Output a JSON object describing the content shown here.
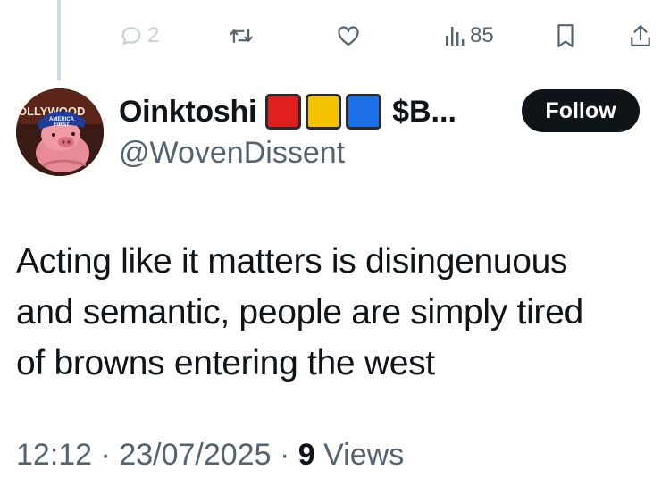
{
  "actions": {
    "reply_count": "2",
    "views_count": "85"
  },
  "user": {
    "display_name": "Oinktoshi",
    "ticker": "$B...",
    "handle": "@WovenDissent",
    "flag_colors": [
      "#e0201f",
      "#f5c200",
      "#1d6fe6"
    ],
    "avatar_hat_text_line1": "AMERICA",
    "avatar_hat_text_line2": "FIRST",
    "avatar_background_text": "OLLYWOOD"
  },
  "follow_label": "Follow",
  "tweet": {
    "lines": [
      "Acting like it matters is disingenuous",
      "and semantic, people are simply tired",
      "of browns entering the west"
    ]
  },
  "meta": {
    "time": "12:12",
    "separator": "·",
    "date": "23/07/2025",
    "views_count": "9",
    "views_label": "Views"
  }
}
